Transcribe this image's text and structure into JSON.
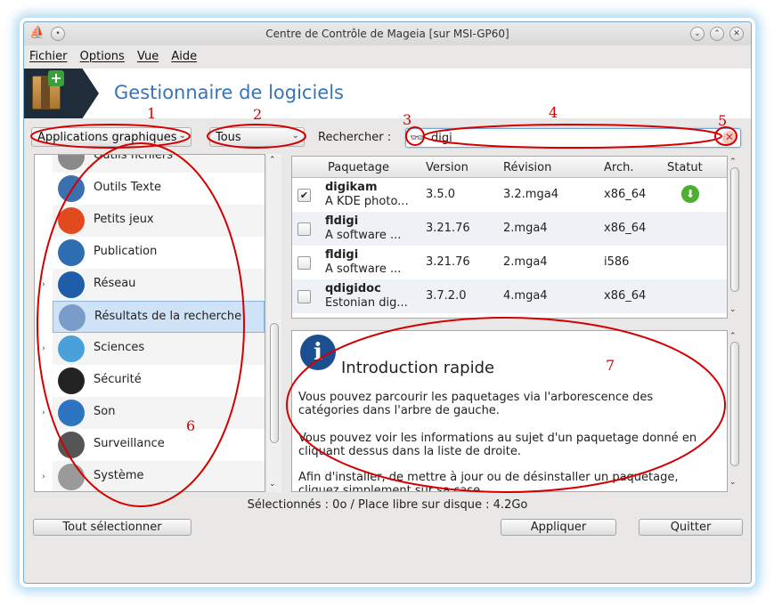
{
  "window": {
    "title": "Centre de Contrôle de Mageia  [sur MSI-GP60]"
  },
  "menubar": [
    "Fichier",
    "Options",
    "Vue",
    "Aide"
  ],
  "banner": {
    "title": "Gestionnaire de logiciels"
  },
  "toolbar": {
    "type_filter": "Applications graphiques",
    "status_filter": "Tous",
    "search_label": "Rechercher :",
    "search_value": "digi"
  },
  "categories": [
    {
      "label": "Outils fichiers",
      "icon": "hard-drive-icon",
      "expandable": false
    },
    {
      "label": "Outils Texte",
      "icon": "text-tools-icon",
      "expandable": false
    },
    {
      "label": "Petits jeux",
      "icon": "games-icon",
      "expandable": false
    },
    {
      "label": "Publication",
      "icon": "publishing-icon",
      "expandable": false
    },
    {
      "label": "Réseau",
      "icon": "globe-icon",
      "expandable": true
    },
    {
      "label": "Résultats de la recherche",
      "icon": "search-results-icon",
      "expandable": false,
      "selected": true
    },
    {
      "label": "Sciences",
      "icon": "flask-icon",
      "expandable": true
    },
    {
      "label": "Sécurité",
      "icon": "police-icon",
      "expandable": false
    },
    {
      "label": "Son",
      "icon": "speaker-icon",
      "expandable": true
    },
    {
      "label": "Surveillance",
      "icon": "monitor-icon",
      "expandable": false
    },
    {
      "label": "Système",
      "icon": "tools-icon",
      "expandable": true
    }
  ],
  "packages": {
    "columns": [
      "Paquetage",
      "Version",
      "Révision",
      "Arch.",
      "Statut"
    ],
    "rows": [
      {
        "name": "digikam",
        "desc": "A KDE photo...",
        "version": "3.5.0",
        "revision": "3.2.mga4",
        "arch": "x86_64",
        "checked": true,
        "status": "download-icon"
      },
      {
        "name": "fldigi",
        "desc": "A software ...",
        "version": "3.21.76",
        "revision": "2.mga4",
        "arch": "x86_64",
        "checked": false
      },
      {
        "name": "fldigi",
        "desc": "A software ...",
        "version": "3.21.76",
        "revision": "2.mga4",
        "arch": "i586",
        "checked": false
      },
      {
        "name": "qdigidoc",
        "desc": "Estonian dig...",
        "version": "3.7.2.0",
        "revision": "4.mga4",
        "arch": "x86_64",
        "checked": false
      }
    ]
  },
  "info": {
    "title": "Introduction rapide",
    "paragraphs": [
      "Vous pouvez parcourir les paquetages via l'arborescence des catégories dans l'arbre de gauche.",
      "Vous pouvez voir les informations au sujet d'un paquetage donné en cliquant dessus dans la liste de droite.",
      "Afin d'installer, de mettre à jour ou de désinstaller un paquetage, cliquez simplement sur sa case."
    ]
  },
  "status": "Sélectionnés : 0o / Place libre sur disque : 4.2Go",
  "buttons": {
    "select_all": "Tout sélectionner",
    "apply": "Appliquer",
    "quit": "Quitter"
  },
  "annotations": [
    "1",
    "2",
    "3",
    "4",
    "5",
    "6",
    "7"
  ],
  "colors": {
    "accent": "#3a74b4",
    "annotation": "#d40000",
    "selection": "#cfe2f6"
  }
}
